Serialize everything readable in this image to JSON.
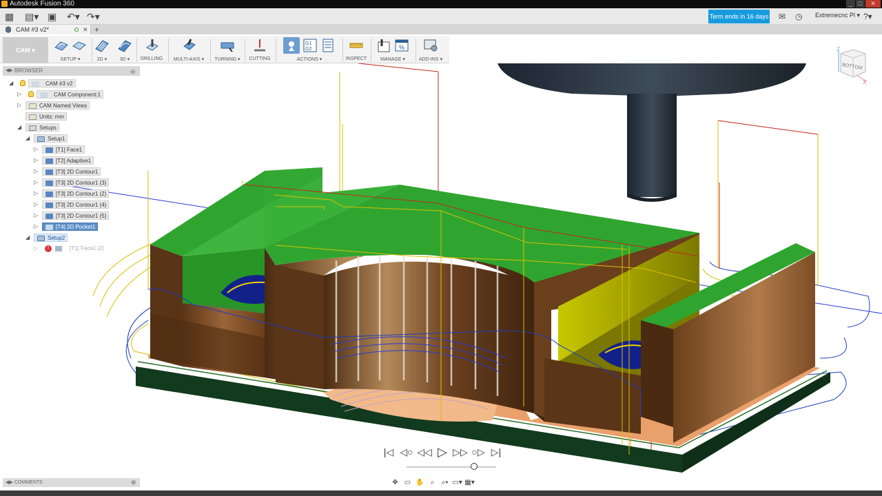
{
  "window": {
    "title": "Autodesk Fusion 360"
  },
  "qat": {
    "trial": "Term ends in 16 days",
    "user": "Extremecnc Pl ▾",
    "icons": [
      "grid-icon",
      "file-icon",
      "save-icon",
      "undo-icon",
      "redo-icon"
    ]
  },
  "tab": {
    "label": "CAM  #3 v2*"
  },
  "toolbar": {
    "workspace": "CAM ▾",
    "groups": [
      {
        "label": "SETUP ▾"
      },
      {
        "label": "2D ▾"
      },
      {
        "label": "3D ▾"
      },
      {
        "label": "DRILLING"
      },
      {
        "label": "MULTI-AXIS ▾"
      },
      {
        "label": "TURNING ▾"
      },
      {
        "label": "CUTTING"
      },
      {
        "label": "ACTIONS ▾"
      },
      {
        "label": "INSPECT"
      },
      {
        "label": "MANAGE ▾"
      },
      {
        "label": "ADD-INS ▾"
      }
    ]
  },
  "browser": {
    "title": "BROWSER",
    "nodes": [
      {
        "label": "CAM #3 v2"
      },
      {
        "label": "CAM Component:1"
      },
      {
        "label": "CAM Named Views"
      },
      {
        "label": "Units: mm"
      },
      {
        "label": "Setups"
      },
      {
        "label": "Setup1"
      },
      {
        "label": "[T1] Face1"
      },
      {
        "label": "[T2] Adaptive1"
      },
      {
        "label": "[T3] 2D Contour1"
      },
      {
        "label": "[T3] 2D Contour1 (3)"
      },
      {
        "label": "[T3] 2D Contour1 (2)"
      },
      {
        "label": "[T3] 2D Contour1 (4)"
      },
      {
        "label": "[T3] 2D Contour1 (5)"
      },
      {
        "label": "[T4] 2D Pocket1"
      },
      {
        "label": "Setup2"
      },
      {
        "label": "[T1] Face1  (2)"
      }
    ]
  },
  "comments": {
    "title": "COMMENTS"
  },
  "viewcube": {
    "face": "BOTTOM",
    "axis_x": "X",
    "axis_z": "Z"
  },
  "colors": {
    "accent": "#189bde",
    "stock_green": "#2fa52f",
    "part_brown": "#7a4a24",
    "fixture_dark": "#0f2f18"
  }
}
